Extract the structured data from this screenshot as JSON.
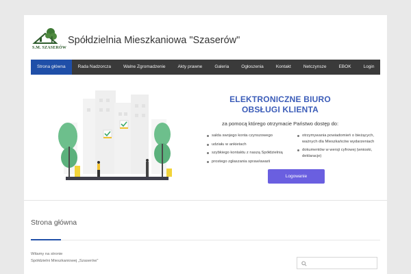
{
  "header": {
    "logo_text": "S.M. SZASERÓW",
    "site_title": "Spółdzielnia Mieszkaniowa \"Szaserów\""
  },
  "nav": {
    "items": [
      {
        "label": "Strona główna",
        "active": true
      },
      {
        "label": "Rada Nadzorcza"
      },
      {
        "label": "Walne Zgromadzenie"
      },
      {
        "label": "Akty prawne"
      },
      {
        "label": "Galeria"
      },
      {
        "label": "Ogłoszenia"
      },
      {
        "label": "Kontakt"
      },
      {
        "label": "Netczynsze"
      },
      {
        "label": "EBOK"
      },
      {
        "label": "Login"
      }
    ]
  },
  "hero": {
    "title_line1": "ELEKTRONICZNE BIURO",
    "title_line2": "OBSŁUGI KLIENTA",
    "subtitle": "za pomocą którego otrzymacie Państwo dostęp do:",
    "left_list": [
      "salda swojego konta czynszowego",
      "udziału w ankietach",
      "szybkiego kontaktu z naszą Spółdzielnią",
      "prostego zgłaszania spraw/awarii"
    ],
    "right_list": [
      "otrzymywania powiadomień o bieżących, ważnych dla Mieszkańców wydarzeniach",
      "dokumentów w wersji cyfrowej (wnioski, deklaracje)"
    ],
    "login_button": "Logowanie"
  },
  "content": {
    "page_heading": "Strona główna",
    "welcome_line1": "Witamy na stronie",
    "welcome_line2": "Spółdzielni Mieszkaniowej „Szaserów\""
  },
  "colors": {
    "nav_bg": "#3a3a3a",
    "nav_active": "#1f4fa8",
    "title_blue": "#3b5cb8",
    "button": "#6a5fe0",
    "tree_green": "#6dbf8c"
  }
}
